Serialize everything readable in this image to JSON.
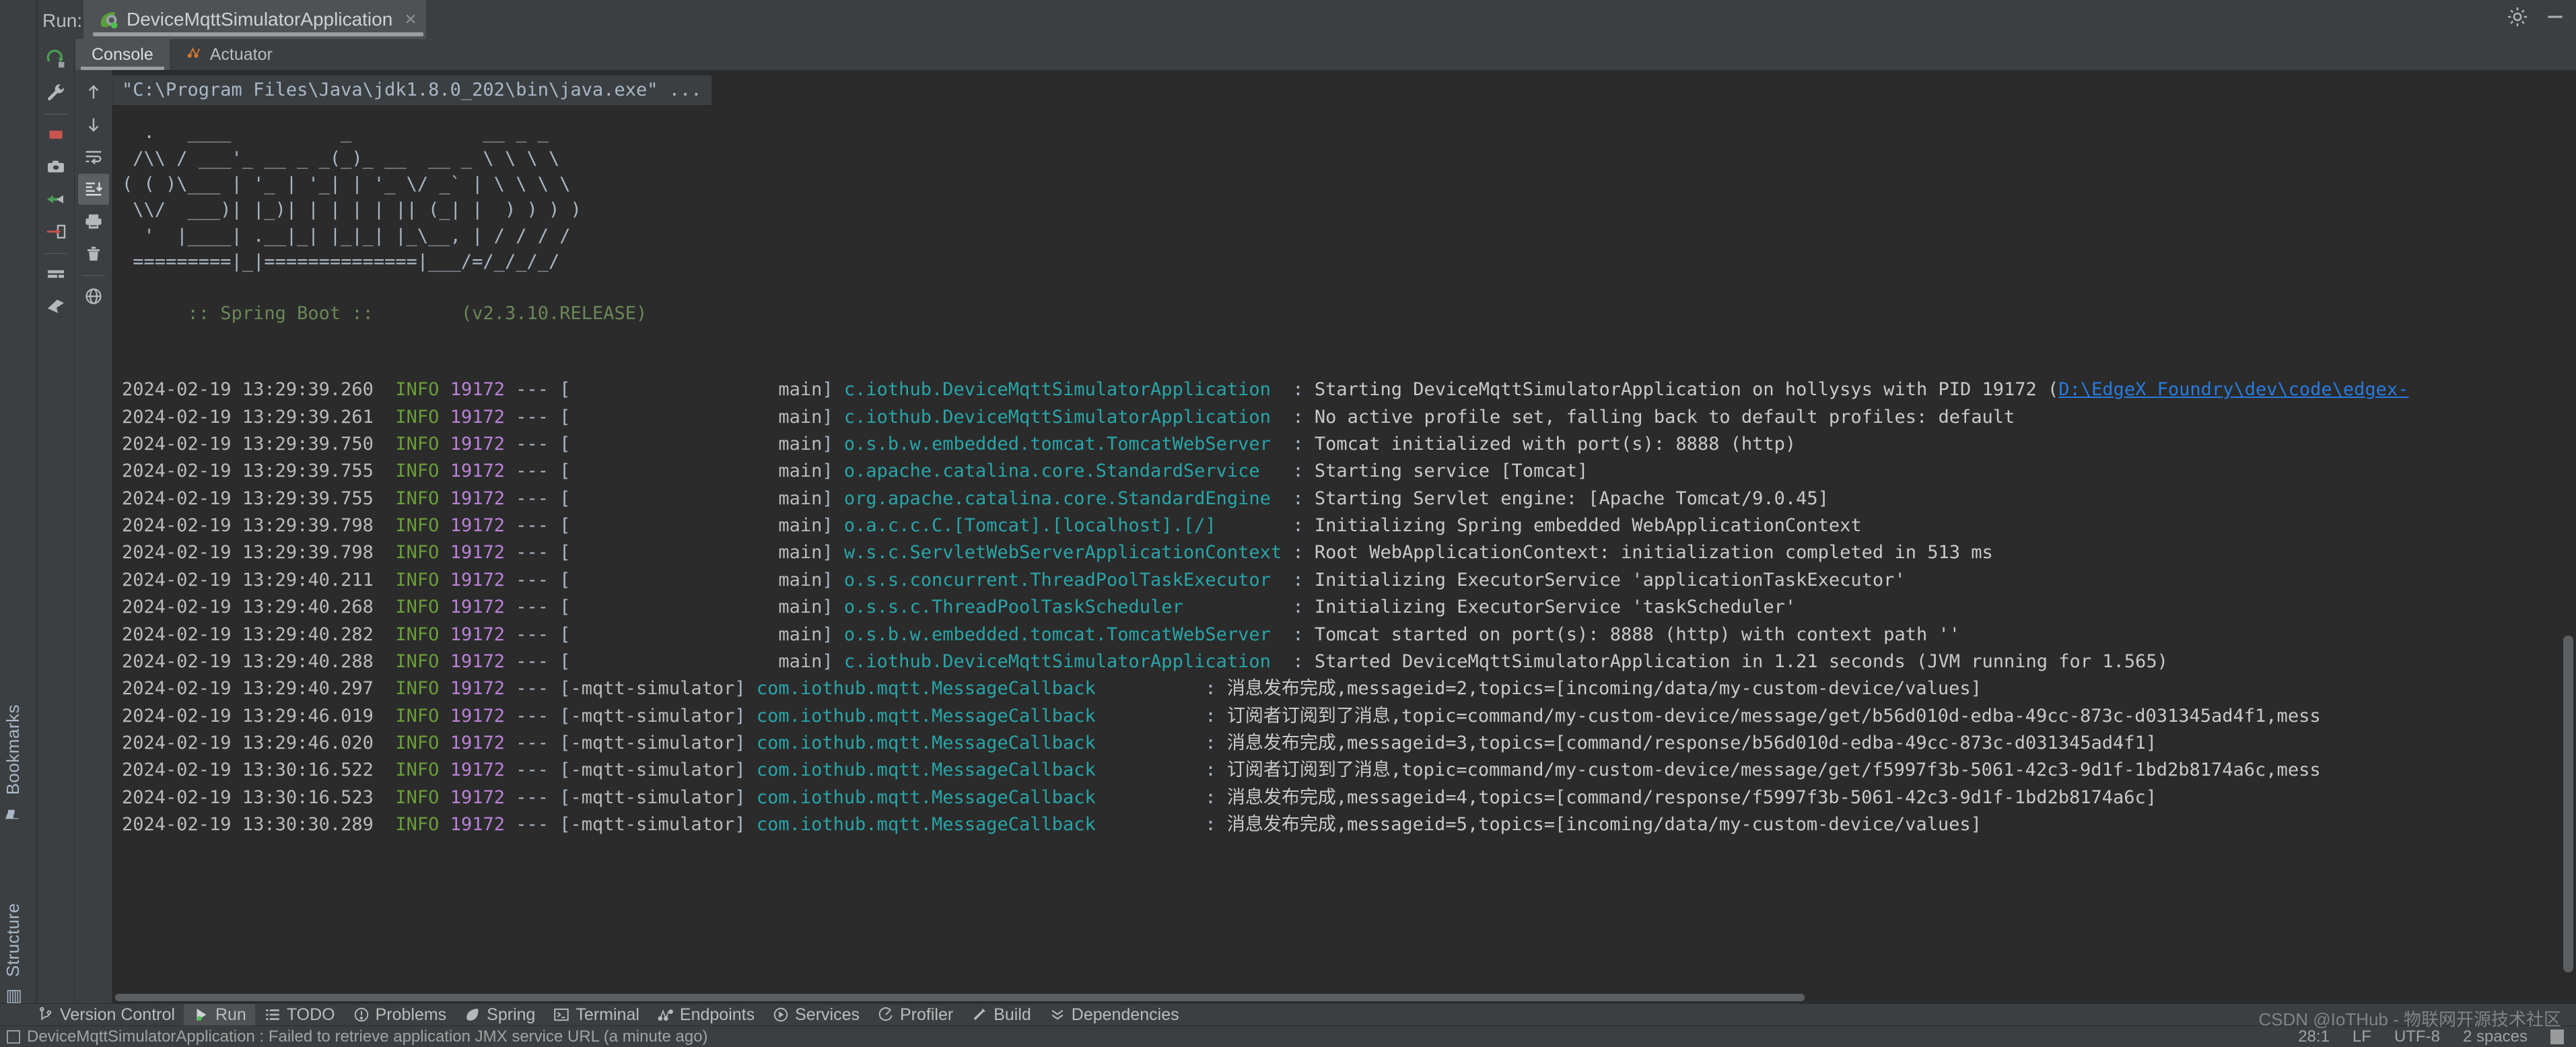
{
  "window": {
    "run_label": "Run:",
    "run_tab_title": "DeviceMqttSimulatorApplication",
    "close_glyph": "×",
    "settings_glyph": "⚙",
    "minimize_glyph": "—"
  },
  "side_labels": {
    "bookmarks": "Bookmarks",
    "structure": "Structure"
  },
  "run_toolbar": [
    {
      "name": "rerun-icon",
      "title": "Rerun"
    },
    {
      "name": "wrench-icon",
      "title": "Modify Run Configuration"
    },
    {
      "name": "stop-icon",
      "title": "Stop"
    },
    {
      "name": "camera-icon",
      "title": "Capture Memory Snapshot"
    },
    {
      "name": "thread-dump-icon",
      "title": "Get Thread Dump"
    },
    {
      "name": "print-icon",
      "title": "Print"
    },
    {
      "name": "clear-all-icon",
      "title": "Clear All"
    },
    {
      "name": "pin-icon",
      "title": "Pin Tab"
    }
  ],
  "scroll_toolbar": [
    {
      "name": "up-arrow-icon",
      "title": "Up"
    },
    {
      "name": "down-arrow-icon",
      "title": "Down"
    },
    {
      "name": "soft-wrap-icon",
      "title": "Soft-Wrap"
    },
    {
      "name": "scroll-to-end-icon",
      "title": "Scroll to End"
    },
    {
      "name": "print-icon",
      "title": "Print"
    },
    {
      "name": "trash-icon",
      "title": "Clear All"
    },
    {
      "name": "browser-icon",
      "title": "Open in Browser"
    },
    {
      "name": "pin-icon",
      "title": "Pin"
    }
  ],
  "tabs": [
    {
      "label": "Console",
      "icon": "console-icon",
      "active": true
    },
    {
      "label": "Actuator",
      "icon": "actuator-icon",
      "active": false
    }
  ],
  "console": {
    "command_line": "\"C:\\Program Files\\Java\\jdk1.8.0_202\\bin\\java.exe\" ...",
    "banner": "  .   ____          _            __ _ _\n /\\\\ / ___'_ __ _ _(_)_ __  __ _ \\ \\ \\ \\\n( ( )\\___ | '_ | '_| | '_ \\/ _` | \\ \\ \\ \\\n \\\\/  ___)| |_)| | | | | || (_| |  ) ) ) )\n  '  |____| .__|_| |_|_| |_\\__, | / / / /\n =========|_|==============|___/=/_/_/_/",
    "boot_label": ":: Spring Boot ::",
    "boot_version": "(v2.3.10.RELEASE)",
    "logs": [
      {
        "ts": "2024-02-19 13:29:39.260",
        "level": "INFO",
        "pid": "19172",
        "thread": "main",
        "logger": "c.iothub.DeviceMqttSimulatorApplication",
        "msg": "Starting DeviceMqttSimulatorApplication on hollysys with PID 19172 (",
        "link": "D:\\EdgeX Foundry\\dev\\code\\edgex-",
        "thread_pad": 23
      },
      {
        "ts": "2024-02-19 13:29:39.261",
        "level": "INFO",
        "pid": "19172",
        "thread": "main",
        "logger": "c.iothub.DeviceMqttSimulatorApplication",
        "msg": "No active profile set, falling back to default profiles: default",
        "link": "",
        "thread_pad": 23
      },
      {
        "ts": "2024-02-19 13:29:39.750",
        "level": "INFO",
        "pid": "19172",
        "thread": "main",
        "logger": "o.s.b.w.embedded.tomcat.TomcatWebServer",
        "msg": "Tomcat initialized with port(s): 8888 (http)",
        "link": "",
        "thread_pad": 23
      },
      {
        "ts": "2024-02-19 13:29:39.755",
        "level": "INFO",
        "pid": "19172",
        "thread": "main",
        "logger": "o.apache.catalina.core.StandardService",
        "msg": "Starting service [Tomcat]",
        "link": "",
        "thread_pad": 23
      },
      {
        "ts": "2024-02-19 13:29:39.755",
        "level": "INFO",
        "pid": "19172",
        "thread": "main",
        "logger": "org.apache.catalina.core.StandardEngine",
        "msg": "Starting Servlet engine: [Apache Tomcat/9.0.45]",
        "link": "",
        "thread_pad": 23
      },
      {
        "ts": "2024-02-19 13:29:39.798",
        "level": "INFO",
        "pid": "19172",
        "thread": "main",
        "logger": "o.a.c.c.C.[Tomcat].[localhost].[/]",
        "msg": "Initializing Spring embedded WebApplicationContext",
        "link": "",
        "thread_pad": 23
      },
      {
        "ts": "2024-02-19 13:29:39.798",
        "level": "INFO",
        "pid": "19172",
        "thread": "main",
        "logger": "w.s.c.ServletWebServerApplicationContext",
        "msg": "Root WebApplicationContext: initialization completed in 513 ms",
        "link": "",
        "thread_pad": 23
      },
      {
        "ts": "2024-02-19 13:29:40.211",
        "level": "INFO",
        "pid": "19172",
        "thread": "main",
        "logger": "o.s.s.concurrent.ThreadPoolTaskExecutor",
        "msg": "Initializing ExecutorService 'applicationTaskExecutor'",
        "link": "",
        "thread_pad": 23
      },
      {
        "ts": "2024-02-19 13:29:40.268",
        "level": "INFO",
        "pid": "19172",
        "thread": "main",
        "logger": "o.s.s.c.ThreadPoolTaskScheduler",
        "msg": "Initializing ExecutorService 'taskScheduler'",
        "link": "",
        "thread_pad": 23
      },
      {
        "ts": "2024-02-19 13:29:40.282",
        "level": "INFO",
        "pid": "19172",
        "thread": "main",
        "logger": "o.s.b.w.embedded.tomcat.TomcatWebServer",
        "msg": "Tomcat started on port(s): 8888 (http) with context path ''",
        "link": "",
        "thread_pad": 23
      },
      {
        "ts": "2024-02-19 13:29:40.288",
        "level": "INFO",
        "pid": "19172",
        "thread": "main",
        "logger": "c.iothub.DeviceMqttSimulatorApplication",
        "msg": "Started DeviceMqttSimulatorApplication in 1.21 seconds (JVM running for 1.565)",
        "link": "",
        "thread_pad": 23
      },
      {
        "ts": "2024-02-19 13:29:40.297",
        "level": "INFO",
        "pid": "19172",
        "thread": "-mqtt-simulator",
        "logger": "com.iothub.mqtt.MessageCallback",
        "msg": "消息发布完成,messageid=2,topics=[incoming/data/my-custom-device/values]",
        "link": "",
        "thread_pad": 0
      },
      {
        "ts": "2024-02-19 13:29:46.019",
        "level": "INFO",
        "pid": "19172",
        "thread": "-mqtt-simulator",
        "logger": "com.iothub.mqtt.MessageCallback",
        "msg": "订阅者订阅到了消息,topic=command/my-custom-device/message/get/b56d010d-edba-49cc-873c-d031345ad4f1,mess",
        "link": "",
        "thread_pad": 0
      },
      {
        "ts": "2024-02-19 13:29:46.020",
        "level": "INFO",
        "pid": "19172",
        "thread": "-mqtt-simulator",
        "logger": "com.iothub.mqtt.MessageCallback",
        "msg": "消息发布完成,messageid=3,topics=[command/response/b56d010d-edba-49cc-873c-d031345ad4f1]",
        "link": "",
        "thread_pad": 0
      },
      {
        "ts": "2024-02-19 13:30:16.522",
        "level": "INFO",
        "pid": "19172",
        "thread": "-mqtt-simulator",
        "logger": "com.iothub.mqtt.MessageCallback",
        "msg": "订阅者订阅到了消息,topic=command/my-custom-device/message/get/f5997f3b-5061-42c3-9d1f-1bd2b8174a6c,mess",
        "link": "",
        "thread_pad": 0
      },
      {
        "ts": "2024-02-19 13:30:16.523",
        "level": "INFO",
        "pid": "19172",
        "thread": "-mqtt-simulator",
        "logger": "com.iothub.mqtt.MessageCallback",
        "msg": "消息发布完成,messageid=4,topics=[command/response/f5997f3b-5061-42c3-9d1f-1bd2b8174a6c]",
        "link": "",
        "thread_pad": 0
      },
      {
        "ts": "2024-02-19 13:30:30.289",
        "level": "INFO",
        "pid": "19172",
        "thread": "-mqtt-simulator",
        "logger": "com.iothub.mqtt.MessageCallback",
        "msg": "消息发布完成,messageid=5,topics=[incoming/data/my-custom-device/values]",
        "link": "",
        "thread_pad": 0
      }
    ]
  },
  "bottom_bar": [
    {
      "label": "Version Control",
      "icon": "branch-icon",
      "active": false
    },
    {
      "label": "Run",
      "icon": "run-play-icon",
      "active": true
    },
    {
      "label": "TODO",
      "icon": "todo-list-icon",
      "active": false
    },
    {
      "label": "Problems",
      "icon": "problems-icon",
      "active": false
    },
    {
      "label": "Spring",
      "icon": "spring-leaf-icon",
      "active": false
    },
    {
      "label": "Terminal",
      "icon": "terminal-icon",
      "active": false
    },
    {
      "label": "Endpoints",
      "icon": "endpoints-icon",
      "active": false
    },
    {
      "label": "Services",
      "icon": "services-icon",
      "active": false
    },
    {
      "label": "Profiler",
      "icon": "profiler-icon",
      "active": false
    },
    {
      "label": "Build",
      "icon": "build-hammer-icon",
      "active": false
    },
    {
      "label": "Dependencies",
      "icon": "dependencies-icon",
      "active": false
    }
  ],
  "status_bar": {
    "message": "DeviceMqttSimulatorApplication : Failed to retrieve application JMX service URL (a minute ago)",
    "caret": "28:1",
    "line_separator": "LF",
    "encoding": "UTF-8",
    "indent": "2 spaces"
  },
  "watermark": "CSDN @IoTHub - 物联网开源技术社区",
  "colors": {
    "background": "#2b2b2b",
    "chrome": "#3c3f41",
    "tab_active": "#4e5254",
    "level_info": "#6a9c3a",
    "pid": "#b982d6",
    "logger": "#29a5a8",
    "link": "#287bde",
    "boot_green": "#6a8759",
    "text": "#a9b7c6"
  }
}
